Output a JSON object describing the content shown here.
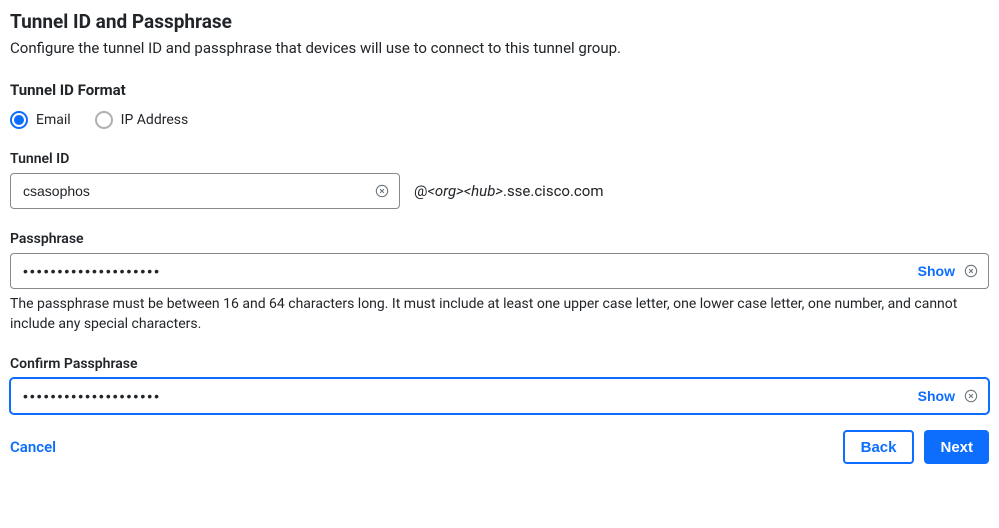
{
  "header": {
    "title": "Tunnel ID and Passphrase",
    "description": "Configure the tunnel ID and passphrase that devices will use to connect to this tunnel group."
  },
  "tunnel_format": {
    "label": "Tunnel ID Format",
    "options": [
      {
        "label": "Email",
        "selected": true
      },
      {
        "label": "IP Address",
        "selected": false
      }
    ]
  },
  "tunnel_id": {
    "label": "Tunnel ID",
    "value": "csasophos",
    "suffix_prefix": "@",
    "suffix_org": "<org>",
    "suffix_hub": "<hub>",
    "suffix_domain": ".sse.cisco.com"
  },
  "passphrase": {
    "label": "Passphrase",
    "value": "••••••••••••••••••••",
    "show_label": "Show",
    "help": "The passphrase must be between 16 and 64 characters long. It must include at least one upper case letter, one lower case letter, one number, and cannot include any special characters."
  },
  "confirm": {
    "label": "Confirm Passphrase",
    "value": "••••••••••••••••••••",
    "show_label": "Show"
  },
  "footer": {
    "cancel": "Cancel",
    "back": "Back",
    "next": "Next"
  }
}
